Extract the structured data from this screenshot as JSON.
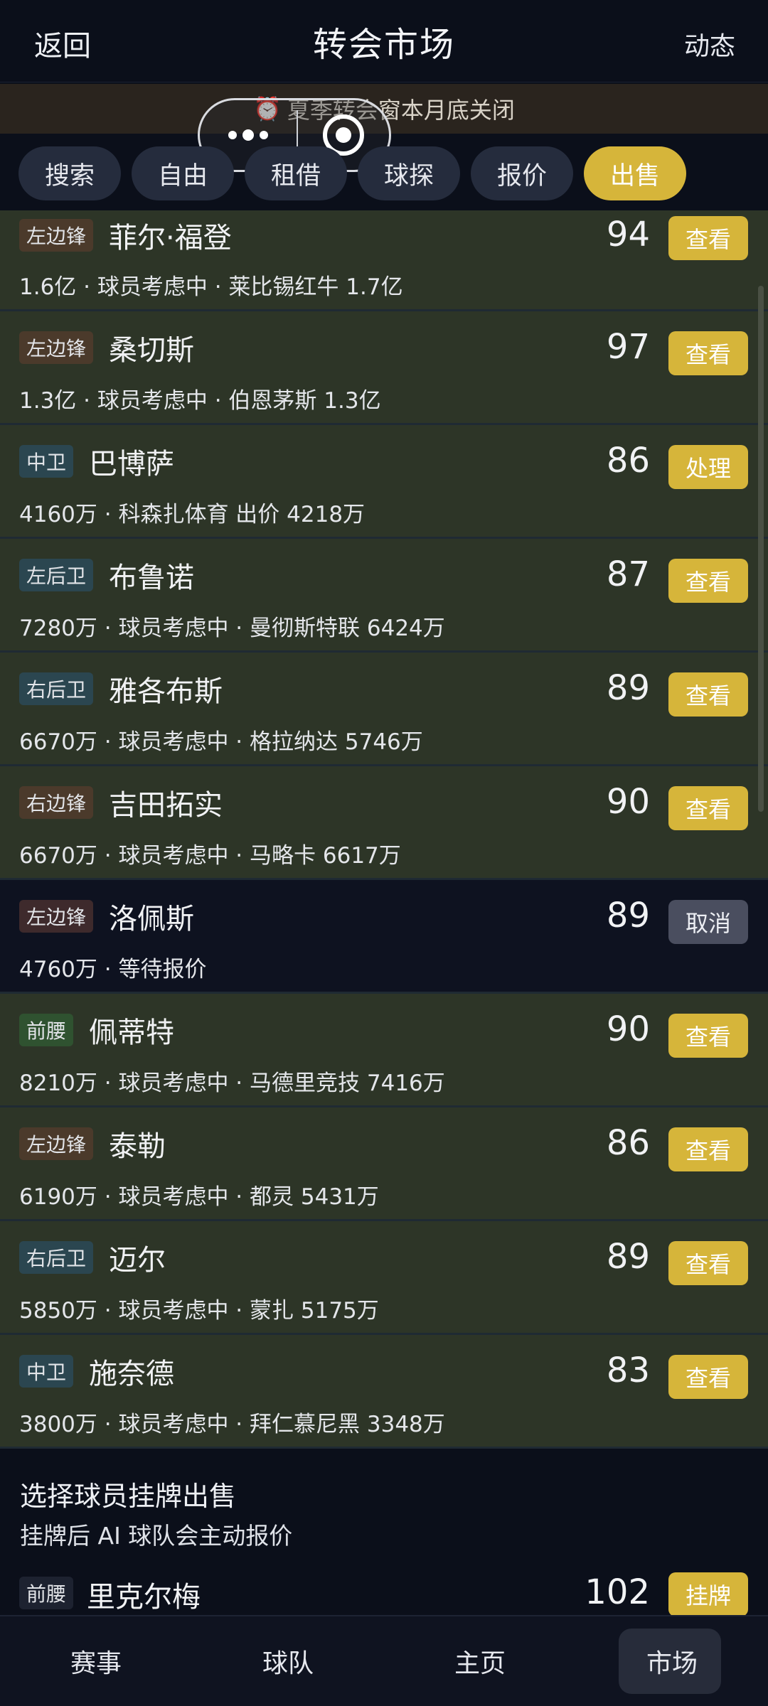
{
  "header": {
    "back_label": "返回",
    "title": "转会市场",
    "news_label": "动态"
  },
  "notice": {
    "icon": "alarm-clock-icon",
    "text": "夏季转会窗本月底关闭"
  },
  "tabs": [
    {
      "label": "搜索",
      "active": false
    },
    {
      "label": "自由",
      "active": false
    },
    {
      "label": "租借",
      "active": false
    },
    {
      "label": "球探",
      "active": false
    },
    {
      "label": "报价",
      "active": false
    },
    {
      "label": "出售",
      "active": true
    }
  ],
  "players": [
    {
      "position": "左边锋",
      "pos_class": "wing",
      "name": "菲尔·福登",
      "rating": "94",
      "button": "查看",
      "info": "1.6亿 · 球员考虑中 · 莱比锡红牛 1.7亿"
    },
    {
      "position": "左边锋",
      "pos_class": "wing",
      "name": "桑切斯",
      "rating": "97",
      "button": "查看",
      "info": "1.3亿 · 球员考虑中 · 伯恩茅斯 1.3亿"
    },
    {
      "position": "中卫",
      "pos_class": "cb",
      "name": "巴博萨",
      "rating": "86",
      "button": "处理",
      "info": "4160万 · 科森扎体育 出价 4218万"
    },
    {
      "position": "左后卫",
      "pos_class": "fb",
      "name": "布鲁诺",
      "rating": "87",
      "button": "查看",
      "info": "7280万 · 球员考虑中 · 曼彻斯特联 6424万"
    },
    {
      "position": "右后卫",
      "pos_class": "fb",
      "name": "雅各布斯",
      "rating": "89",
      "button": "查看",
      "info": "6670万 · 球员考虑中 · 格拉纳达 5746万"
    },
    {
      "position": "右边锋",
      "pos_class": "wing",
      "name": "吉田拓实",
      "rating": "90",
      "button": "查看",
      "info": "6670万 · 球员考虑中 · 马略卡 6617万"
    },
    {
      "position": "左边锋",
      "pos_class": "wingdark",
      "name": "洛佩斯",
      "rating": "89",
      "button": "取消",
      "info": "4760万 · 等待报价"
    },
    {
      "position": "前腰",
      "pos_class": "cam",
      "name": "佩蒂特",
      "rating": "90",
      "button": "查看",
      "info": "8210万 · 球员考虑中 · 马德里竞技 7416万"
    },
    {
      "position": "左边锋",
      "pos_class": "wing",
      "name": "泰勒",
      "rating": "86",
      "button": "查看",
      "info": "6190万 · 球员考虑中 · 都灵 5431万"
    },
    {
      "position": "右后卫",
      "pos_class": "fb",
      "name": "迈尔",
      "rating": "89",
      "button": "查看",
      "info": "5850万 · 球员考虑中 · 蒙扎 5175万"
    },
    {
      "position": "中卫",
      "pos_class": "cb",
      "name": "施奈德",
      "rating": "83",
      "button": "查看",
      "info": "3800万 · 球员考虑中 · 拜仁慕尼黑 3348万"
    }
  ],
  "sale": {
    "heading": "选择球员挂牌出售",
    "subheading": "挂牌后 AI 球队会主动报价",
    "player": {
      "position": "前腰",
      "name": "里克尔梅",
      "rating": "102",
      "button": "挂牌"
    }
  },
  "bottom_nav": [
    {
      "label": "赛事",
      "active": false
    },
    {
      "label": "球队",
      "active": false
    },
    {
      "label": "主页",
      "active": false
    },
    {
      "label": "市场",
      "active": true
    }
  ],
  "colors": {
    "accent": "#d6b53a",
    "background": "#0b0f1a",
    "row_bg": "#2d3527"
  }
}
